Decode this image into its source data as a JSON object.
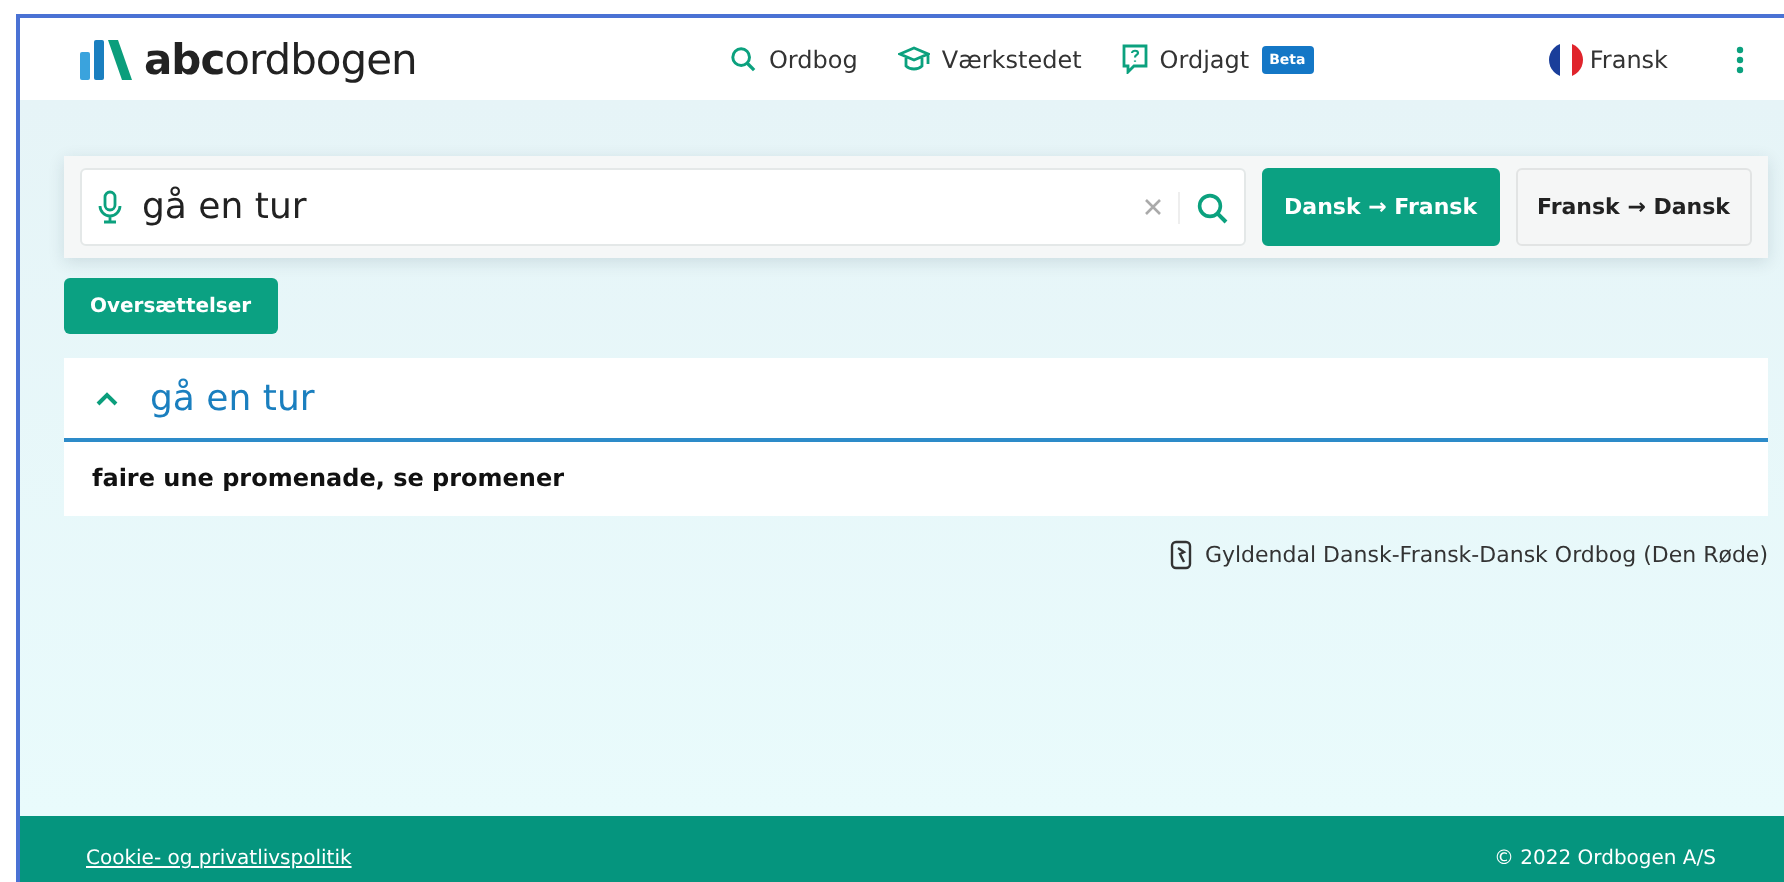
{
  "header": {
    "logo": {
      "brand": "abc",
      "name": "ordbogen"
    },
    "nav": [
      {
        "kind": "search",
        "label": "Ordbog"
      },
      {
        "kind": "cap",
        "label": "Værkstedet"
      },
      {
        "kind": "quiz",
        "label": "Ordjagt",
        "badge": "Beta"
      }
    ],
    "language": "Fransk"
  },
  "search": {
    "value": "gå en tur",
    "directions": [
      {
        "label": "Dansk → Fransk",
        "selected": true
      },
      {
        "label": "Fransk → Dansk",
        "selected": false
      }
    ]
  },
  "section_button": "Oversættelser",
  "result": {
    "headword": "gå en tur",
    "expanded": true,
    "translation": "faire une promenade, se promener"
  },
  "source": "Gyldendal Dansk-Fransk-Dansk Ordbog (Den Røde)",
  "footer": {
    "link": "Cookie- og privatlivspolitik",
    "copyright": "© 2022 Ordbogen A/S"
  }
}
